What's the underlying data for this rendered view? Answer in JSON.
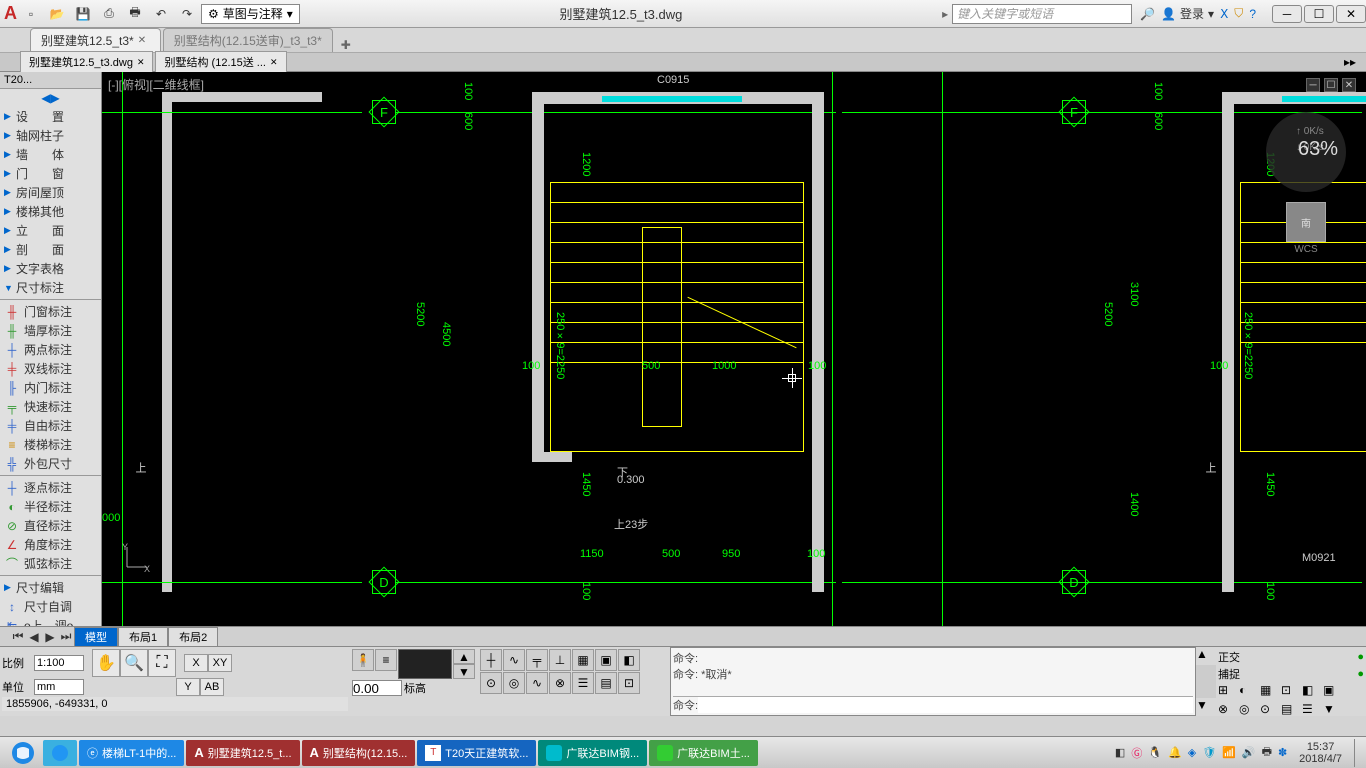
{
  "app": {
    "title": "别墅建筑12.5_t3.dwg",
    "workspace": "草图与注释",
    "search_placeholder": "键入关键字或短语",
    "login": "登录"
  },
  "file_tabs": [
    {
      "label": "别墅建筑12.5_t3*",
      "active": true
    },
    {
      "label": "别墅结构(12.15送审)_t3_t3*",
      "active": false
    }
  ],
  "doc_tabs": [
    {
      "label": "别墅建筑12.5_t3.dwg"
    },
    {
      "label": "别墅结构 (12.15送 ..."
    }
  ],
  "left_panel": {
    "title": "T20...",
    "items_top": [
      {
        "label": "设　　置"
      },
      {
        "label": "轴网柱子"
      },
      {
        "label": "墙　　体"
      },
      {
        "label": "门　　窗"
      },
      {
        "label": "房间屋顶"
      },
      {
        "label": "楼梯其他"
      },
      {
        "label": "立　　面"
      },
      {
        "label": "剖　　面"
      },
      {
        "label": "文字表格"
      },
      {
        "label": "尺寸标注"
      }
    ],
    "items_mid": [
      {
        "label": "门窗标注"
      },
      {
        "label": "墙厚标注"
      },
      {
        "label": "两点标注"
      },
      {
        "label": "双线标注"
      },
      {
        "label": "内门标注"
      },
      {
        "label": "快速标注"
      },
      {
        "label": "自由标注"
      },
      {
        "label": "楼梯标注"
      },
      {
        "label": "外包尺寸"
      }
    ],
    "items_bot": [
      {
        "label": "逐点标注"
      },
      {
        "label": "半径标注"
      },
      {
        "label": "直径标注"
      },
      {
        "label": "角度标注"
      },
      {
        "label": "弧弦标注"
      }
    ],
    "items_last": [
      {
        "label": "尺寸编辑"
      },
      {
        "label": "尺寸自调"
      },
      {
        "label": "o上　调o"
      }
    ]
  },
  "canvas": {
    "view_label": "[-][俯视][二维线框]",
    "overlay_pct": "63%",
    "speed_up": "0K/s",
    "speed_down": "0K/s",
    "viewcube": "南",
    "wcs": "WCS",
    "dims": {
      "d100a": "100",
      "d600": "600",
      "d1200": "1200",
      "d5200": "5200",
      "d4500": "4500",
      "d100b": "100",
      "d2509": "250×9=2250",
      "d500": "500",
      "d1000": "1000",
      "d100c": "100",
      "d1450": "1450",
      "d0300": "0.300",
      "d23steps": "上23步",
      "d1150": "1150",
      "d500b": "500",
      "d950": "950",
      "d100d": "100",
      "d3100": "3100",
      "d1400": "1400",
      "dC0915": "C0915",
      "dM0921": "M0921",
      "dD": "D",
      "dF": "F",
      "d000": "000",
      "dShang": "上",
      "dXia": "下"
    }
  },
  "layout_tabs": {
    "tabs": [
      {
        "label": "模型",
        "active": true
      },
      {
        "label": "布局1",
        "active": false
      },
      {
        "label": "布局2",
        "active": false
      }
    ]
  },
  "status": {
    "scale_label": "比例",
    "scale_value": "1:100",
    "unit_label": "单位",
    "unit_value": "mm",
    "coords": "1855906, -649331, 0",
    "elev_label": "标高",
    "elev_value": "0.00",
    "cmd_history_1": "命令:",
    "cmd_history_2": "命令:  *取消*",
    "cmd_prompt": "命令:",
    "ortho": "正交",
    "snap": "捕捉"
  },
  "taskbar": {
    "items": [
      {
        "label": "楼梯LT-1中的...",
        "color": "#1e88e5"
      },
      {
        "label": "别墅建筑12.5_t...",
        "color": "#c62828"
      },
      {
        "label": "别墅结构(12.15...",
        "color": "#c62828"
      },
      {
        "label": "T20天正建筑软...",
        "color": "#1565c0"
      },
      {
        "label": "广联达BIM钢...",
        "color": "#00897b"
      },
      {
        "label": "广联达BIM土...",
        "color": "#43a047"
      }
    ],
    "time": "15:37",
    "date": "2018/4/7"
  }
}
